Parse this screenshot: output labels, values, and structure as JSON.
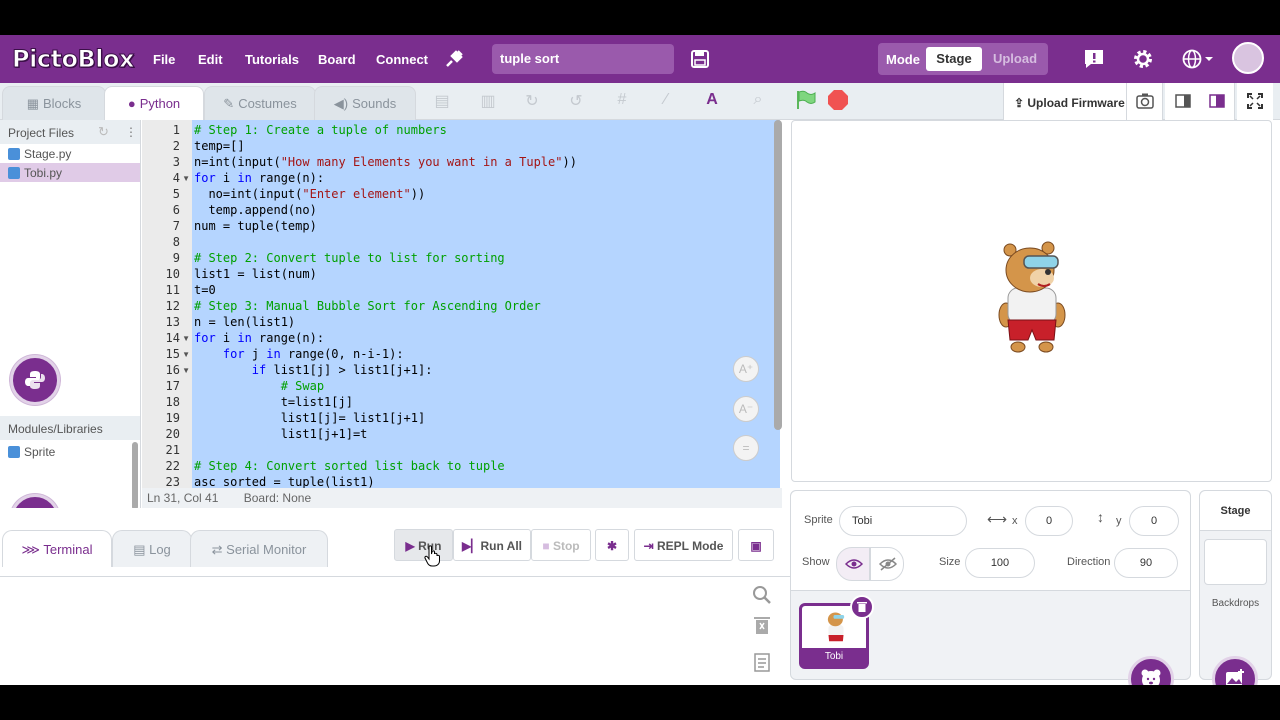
{
  "topbar": {
    "logo": "PictoBlox",
    "menu": [
      "File",
      "Edit",
      "Tutorials",
      "Board",
      "Connect"
    ],
    "project_name": "tuple sort",
    "mode_label": "Mode",
    "mode_stage": "Stage",
    "mode_upload": "Upload"
  },
  "tabs": {
    "blocks": "Blocks",
    "python": "Python",
    "costumes": "Costumes",
    "sounds": "Sounds",
    "upload_firmware": "Upload Firmware"
  },
  "left_panel": {
    "project_files": "Project Files",
    "files": [
      "Stage.py",
      "Tobi.py"
    ],
    "modules": "Modules/Libraries",
    "module_items": [
      "Sprite"
    ]
  },
  "editor": {
    "lines": [
      "1",
      "2",
      "3",
      "4",
      "5",
      "6",
      "7",
      "8",
      "9",
      "10",
      "11",
      "12",
      "13",
      "14",
      "15",
      "16",
      "17",
      "18",
      "19",
      "20",
      "21",
      "22",
      "23"
    ],
    "status_pos": "Ln 31, Col 41",
    "status_board": "Board: None"
  },
  "bottom": {
    "terminal": "Terminal",
    "log": "Log",
    "serial": "Serial Monitor",
    "run": "Run",
    "run_all": "Run All",
    "stop": "Stop",
    "repl": "REPL Mode"
  },
  "sprite": {
    "sprite_label": "Sprite",
    "sprite_name": "Tobi",
    "x_label": "x",
    "x": "0",
    "y_label": "y",
    "y": "0",
    "show_label": "Show",
    "size_label": "Size",
    "size": "100",
    "direction_label": "Direction",
    "direction": "90",
    "thumb_name": "Tobi"
  },
  "stage_panel": {
    "title": "Stage",
    "backdrops": "Backdrops"
  },
  "colors": {
    "brand": "#7a2e8e",
    "selection": "#b5d5ff",
    "comment": "#00a000",
    "keyword": "#0000ff",
    "string": "#a31515"
  }
}
